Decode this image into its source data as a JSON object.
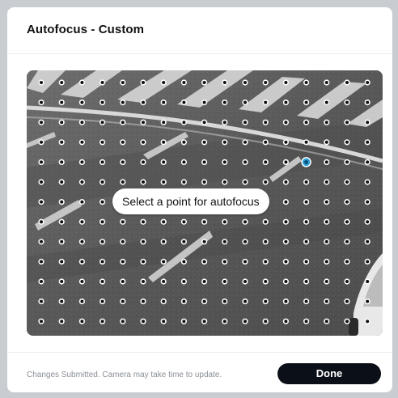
{
  "dialog": {
    "title": "Autofocus - Custom",
    "hint": "Select a point for autofocus",
    "status": "Changes Submitted. Camera may take time to update.",
    "done_label": "Done"
  },
  "focus_grid": {
    "columns": 17,
    "rows": 13,
    "selected_column": 13,
    "selected_row": 4
  },
  "colors": {
    "selected_point": "#2a9fd6",
    "done_button": "#0b0f17"
  },
  "icons": {
    "focus_point": "focus-point-icon"
  }
}
